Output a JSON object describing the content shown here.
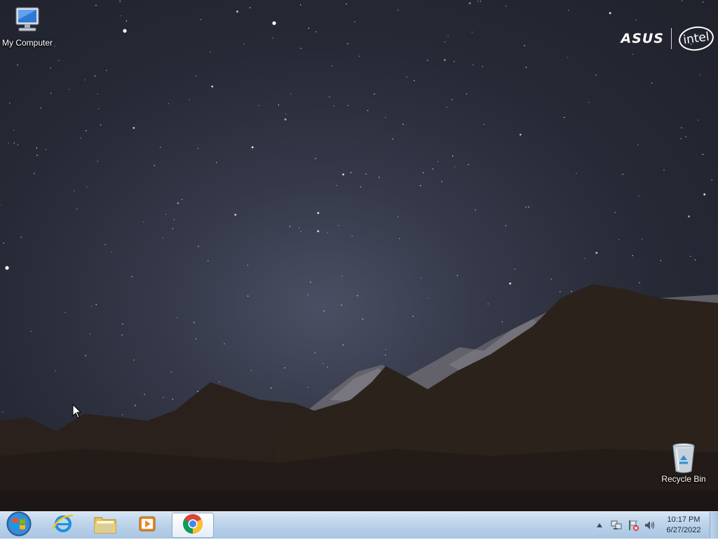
{
  "desktop": {
    "icons": [
      {
        "label": "My Computer",
        "icon": "computer-icon"
      },
      {
        "label": "Recycle Bin",
        "icon": "recycle-bin-icon"
      }
    ],
    "wallpaper": "night-sky-mountains",
    "brand": {
      "asus": "ASUS",
      "intel": "intel"
    }
  },
  "taskbar": {
    "start": {
      "icon": "windows-logo-icon"
    },
    "pinned": [
      {
        "name": "internet-explorer",
        "icon": "internet-explorer-icon"
      },
      {
        "name": "windows-explorer",
        "icon": "folder-icon"
      },
      {
        "name": "media-player",
        "icon": "media-player-icon"
      },
      {
        "name": "chrome",
        "icon": "chrome-icon",
        "active": true
      }
    ],
    "tray": {
      "icons": [
        "show-hidden-icons-icon",
        "network-icon",
        "action-center-icon",
        "volume-icon"
      ],
      "time": "10:17 PM",
      "date": "6/27/2022"
    }
  },
  "colors": {
    "taskbar_top": "#d6e6f5",
    "taskbar_bottom": "#a9c5e2",
    "sky_center": "#4a4f63",
    "sky_edge": "#1f222b"
  }
}
